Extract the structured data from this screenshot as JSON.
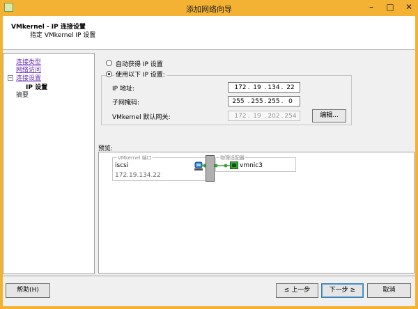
{
  "window": {
    "title": "添加网络向导",
    "min_glyph": "–",
    "max_glyph": "□",
    "close_glyph": "✕"
  },
  "header": {
    "title": "VMkernel - IP 连接设置",
    "subtitle": "指定 VMkernel IP 设置"
  },
  "nav": {
    "links": [
      "连接类型",
      "网络访问",
      "连接设置"
    ],
    "current": "IP 设置",
    "summary": "摘要",
    "tree_toggle": "−"
  },
  "ip_settings": {
    "auto_label": "自动获得 IP 设置",
    "manual_label": "使用以下 IP 设置:",
    "selected": "manual",
    "ip_label": "IP 地址:",
    "ip": [
      "172",
      "19",
      "134",
      "22"
    ],
    "mask_label": "子网掩码:",
    "mask": [
      "255",
      "255",
      "255",
      "0"
    ],
    "gateway_label": "VMkernel 默认网关:",
    "gateway": [
      "172",
      "19",
      "202",
      "254"
    ],
    "edit_button": "编辑...",
    "dot": "."
  },
  "preview": {
    "label": "预览:",
    "vmkernel_group": "VMkernel 端口",
    "port_name": "iscsi",
    "port_ip": "172.19.134.22",
    "adapter_group": "物理适配器",
    "nic": "vmnic3"
  },
  "footer": {
    "help": "帮助(H)",
    "back": "≤ 上一步",
    "next": "下一步 ≥",
    "cancel": "取消"
  },
  "colors": {
    "frame": "#f3b233",
    "link": "#6a2fb5",
    "accent_green": "#3aa23a"
  }
}
